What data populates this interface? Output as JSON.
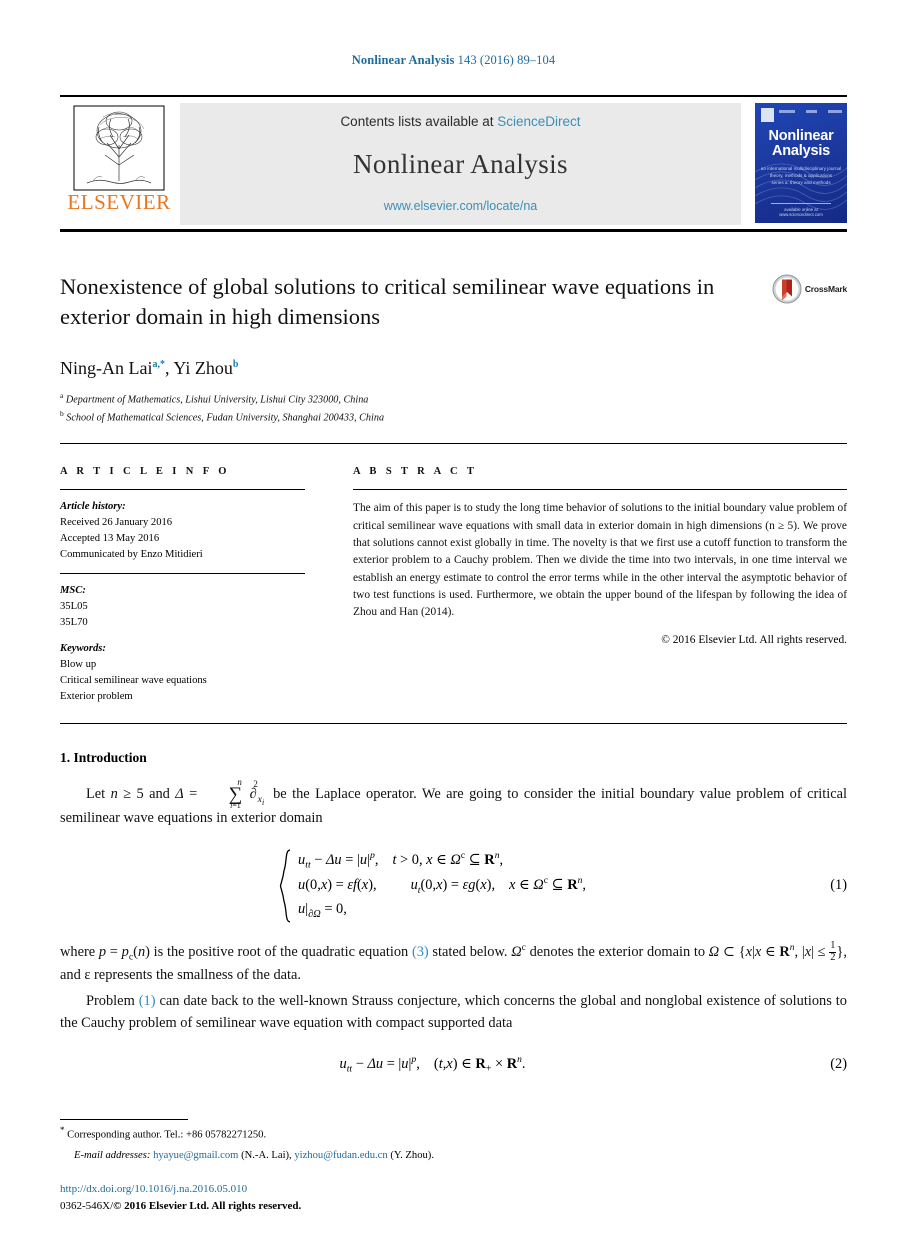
{
  "running_head": {
    "journal": "Nonlinear Analysis",
    "citation": " 143 (2016) 89–104"
  },
  "masthead": {
    "publisher": "ELSEVIER",
    "contents_prefix": "Contents lists available at ",
    "contents_link": "ScienceDirect",
    "journal_name": "Nonlinear Analysis",
    "journal_url": "www.elsevier.com/locate/na",
    "cover": {
      "title_line1": "Nonlinear",
      "title_line2": "Analysis",
      "sub_line1": "an international multidisciplinary journal",
      "sub_line2": "theory, methods & applications",
      "sub_line3": "series a: theory and methods",
      "footer": "available online at www.sciencedirect.com"
    }
  },
  "article": {
    "title": "Nonexistence of global solutions to critical semilinear wave equations in exterior domain in high dimensions",
    "crossmark_label": "CrossMark",
    "authors": [
      {
        "name": "Ning-An Lai",
        "marks": "a,*"
      },
      {
        "name": "Yi Zhou",
        "marks": "b"
      }
    ],
    "affiliations": [
      {
        "mark": "a",
        "text": "Department of Mathematics, Lishui University, Lishui City 323000, China"
      },
      {
        "mark": "b",
        "text": "School of Mathematical Sciences, Fudan University, Shanghai 200433, China"
      }
    ]
  },
  "article_info": {
    "heading": "A R T I C L E    I N F O",
    "history_label": "Article history:",
    "history": [
      "Received 26 January 2016",
      "Accepted 13 May 2016",
      "Communicated by Enzo Mitidieri"
    ],
    "msc_label": "MSC:",
    "msc": [
      "35L05",
      "35L70"
    ],
    "keywords_label": "Keywords:",
    "keywords": [
      "Blow up",
      "Critical semilinear wave equations",
      "Exterior problem"
    ]
  },
  "abstract": {
    "heading": "A B S T R A C T",
    "text": "The aim of this paper is to study the long time behavior of solutions to the initial boundary value problem of critical semilinear wave equations with small data in exterior domain in high dimensions (n ≥ 5). We prove that solutions cannot exist globally in time. The novelty is that we first use a cutoff function to transform the exterior problem to a Cauchy problem. Then we divide the time into two intervals, in one time interval we establish an energy estimate to control the error terms while in the other interval the asymptotic behavior of two test functions is used. Furthermore, we obtain the upper bound of the lifespan by following the idea of Zhou and Han (2014).",
    "copyright": "© 2016 Elsevier Ltd. All rights reserved."
  },
  "body": {
    "section_heading": "1. Introduction",
    "para1_pre": "Let ",
    "para1_mid": " be the Laplace operator. We are going to consider the initial boundary value problem of critical semilinear wave equations in exterior domain",
    "eq1_number": "(1)",
    "eq2_number": "(2)",
    "para2_a": "where ",
    "para2_b": " is the positive root of the quadratic equation ",
    "para2_eqref": "(3)",
    "para2_c": " stated below. ",
    "para2_d": " denotes the exterior domain to ",
    "para2_e": ", and ε represents the smallness of the data.",
    "para3_a": "Problem ",
    "para3_eqref": "(1)",
    "para3_b": " can date back to the well-known Strauss conjecture, which concerns the global and nonglobal existence of solutions to the Cauchy problem of semilinear wave equation with compact supported data"
  },
  "footnotes": {
    "corresponding": "Corresponding author. Tel.: +86 05782271250.",
    "email_label": "E-mail addresses:",
    "emails": [
      {
        "address": "hyayue@gmail.com",
        "owner": "(N.-A. Lai),"
      },
      {
        "address": "yizhou@fudan.edu.cn",
        "owner": "(Y. Zhou)."
      }
    ],
    "doi": "http://dx.doi.org/10.1016/j.na.2016.05.010",
    "issn_line_plain": "0362-546X/",
    "issn_line_bold": "© 2016 Elsevier Ltd. All rights reserved."
  },
  "colors": {
    "link": "#1f6b9c",
    "sciencedirect": "#3b8fb5",
    "elsevier_orange": "#e87722",
    "eqref": "#2f8ec4",
    "cover_blue": "#1c39a0"
  }
}
